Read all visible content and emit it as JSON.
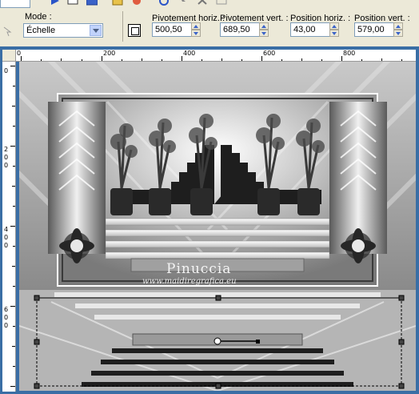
{
  "toolbar": {
    "mode_label": "Mode :",
    "mode_value": "Échelle",
    "pivot_h_label": "Pivotement horiz. :",
    "pivot_h_value": "500,50",
    "pivot_v_label": "Pivotement vert. :",
    "pivot_v_value": "689,50",
    "pos_h_label": "Position horiz. :",
    "pos_h_value": "43,00",
    "pos_v_label": "Position vert. :",
    "pos_v_value": "579,00"
  },
  "ruler": {
    "h_labels": [
      "0",
      "200",
      "400",
      "600",
      "800"
    ],
    "v_labels": [
      "0",
      "2 0 0",
      "4 0 0",
      "6 0 0"
    ]
  },
  "image": {
    "watermark_title": "Pinuccia",
    "watermark_url": "www.maidiregrafica.eu"
  }
}
